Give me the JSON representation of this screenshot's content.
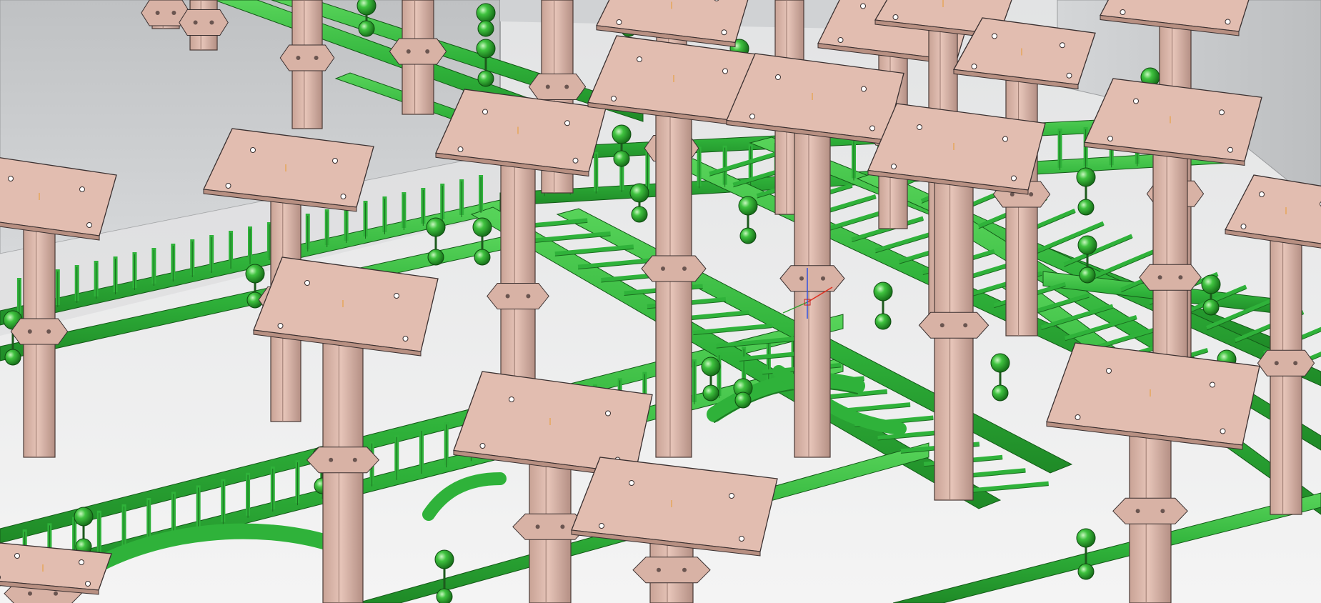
{
  "viewport": {
    "background": "#ffffff",
    "wall_color": "#c9cbcd",
    "floor_color": "#e9eaeb",
    "tray_color": "#2fb23a",
    "tray_shade": "#1d7a24",
    "tray_light": "#6fe06a",
    "support_color": "#dcb4a6",
    "support_shade": "#a8837a",
    "support_edge": "#3a3030",
    "axis_x_color": "#e03020",
    "axis_y_color": "#30a030",
    "axis_z_color": "#3050e0"
  }
}
